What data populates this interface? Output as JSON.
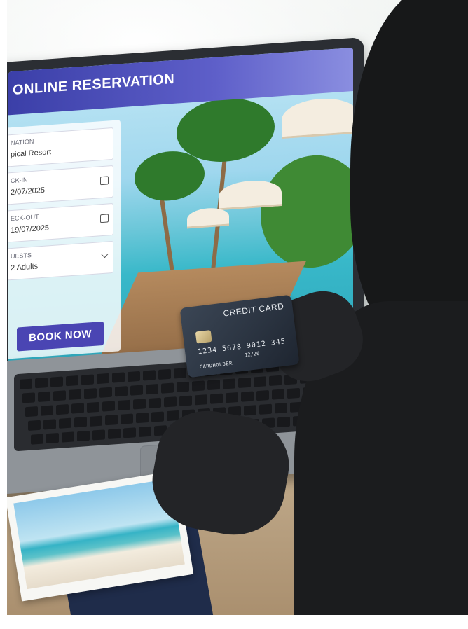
{
  "screen": {
    "title": "ONLINE RESERVATION",
    "destination": {
      "label": "NATION",
      "value": "pical Resort"
    },
    "checkin": {
      "label": "CK-IN",
      "value": "2/07/2025"
    },
    "checkout": {
      "label": "ECK-OUT",
      "value": "19/07/2025"
    },
    "guests": {
      "label": "UESTS",
      "value": "2 Adults"
    },
    "book_button": "BOOK NOW",
    "header_color": "#4a45b3"
  },
  "card": {
    "title": "CREDIT CARD",
    "number": "1234 5678 9012 345",
    "expiry": "12/26",
    "holder": "CARDHOLDER"
  },
  "icons": [
    "calendar-icon",
    "chevron-down-icon",
    "card-chip-icon"
  ]
}
